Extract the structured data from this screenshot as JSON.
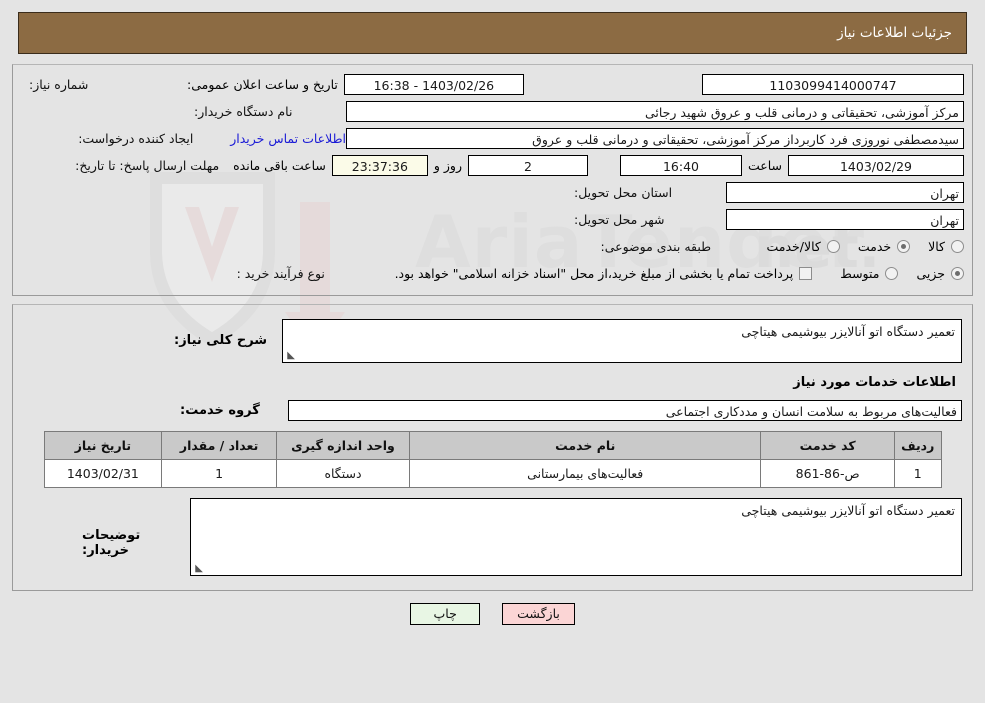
{
  "header": {
    "title": "جزئیات اطلاعات نیاز"
  },
  "announcement": {
    "label": "تاریخ و ساعت اعلان عمومی:",
    "value": "1403/02/26 - 16:38"
  },
  "form": {
    "need_number": {
      "label": "شماره نیاز:",
      "value": "1103099414000747"
    },
    "buyer_org": {
      "label": "نام دستگاه خریدار:",
      "value": "مرکز آموزشی، تحقیقاتی و درمانی قلب و عروق شهید رجائی"
    },
    "creator": {
      "label": "ایجاد کننده درخواست:",
      "value": "سیدمصطفی نوروزی فرد کاربرداز مرکز آموزشی، تحقیقاتی و درمانی قلب و عروق",
      "contact_link": "اطلاعات تماس خریدار"
    },
    "deadline": {
      "label": "مهلت ارسال پاسخ: تا تاریخ:",
      "date": "1403/02/29",
      "time_label": "ساعت",
      "time": "16:40",
      "days": "2",
      "days_label": "روز و",
      "remaining": "23:37:36",
      "remaining_label": "ساعت باقی مانده"
    },
    "province": {
      "label": "استان محل تحویل:",
      "value": "تهران"
    },
    "city": {
      "label": "شهر محل تحویل:",
      "value": "تهران"
    },
    "category": {
      "label": "طبقه بندی موضوعی:",
      "options": [
        "کالا",
        "خدمت",
        "کالا/خدمت"
      ],
      "selected": "خدمت"
    },
    "process": {
      "label": "نوع فرآیند خرید :",
      "options": [
        "جزیی",
        "متوسط"
      ],
      "selected": "جزیی",
      "treasury_checkbox_label": "پرداخت تمام یا بخشی از مبلغ خرید،از محل \"اسناد خزانه اسلامی\" خواهد بود.",
      "treasury_checked": false
    }
  },
  "description": {
    "label": "شرح کلی نیاز:",
    "value": "تعمیر دستگاه اتو آنالایزر بیوشیمی هیتاچی"
  },
  "services_section": {
    "heading": "اطلاعات خدمات مورد نیاز",
    "group_label": "گروه خدمت:",
    "group_value": "فعالیت‌های مربوط به سلامت انسان و مددکاری اجتماعی"
  },
  "table": {
    "columns": [
      "ردیف",
      "کد خدمت",
      "نام خدمت",
      "واحد اندازه گیری",
      "تعداد / مقدار",
      "تاریخ نیاز"
    ],
    "rows": [
      {
        "radif": "1",
        "code": "ص-86-861",
        "name": "فعالیت‌های بیمارستانی",
        "unit": "دستگاه",
        "qty": "1",
        "date": "1403/02/31"
      }
    ]
  },
  "buyer_notes": {
    "label": "توضیحات خریدار:",
    "value": "تعمیر دستگاه اتو آنالایزر بیوشیمی هیتاچی"
  },
  "buttons": {
    "print": "چاپ",
    "back": "بازگشت"
  },
  "watermark": {
    "text": "AriaTender.net"
  },
  "colors": {
    "header_bg": "#8c6b43",
    "link": "#1a1ad6",
    "print_btn": "#e8f6e4",
    "back_btn": "#fbd5d5",
    "table_header": "#c9c9c9",
    "countdown_bg": "#fbfbe8"
  }
}
